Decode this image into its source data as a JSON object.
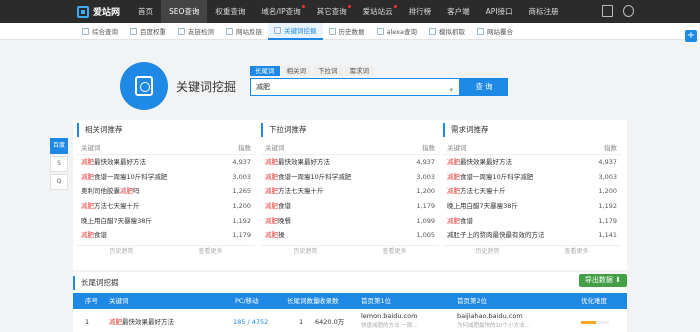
{
  "brand": {
    "name": "爱站网"
  },
  "topnav": {
    "items": [
      {
        "label": "首页"
      },
      {
        "label": "SEO查询",
        "active": true
      },
      {
        "label": "权重查询"
      },
      {
        "label": "域名/IP查询",
        "dot": true
      },
      {
        "label": "其它查询",
        "dot": true
      },
      {
        "label": "爱站站云",
        "dot": true
      },
      {
        "label": "排行榜"
      },
      {
        "label": "客户端"
      },
      {
        "label": "API接口"
      },
      {
        "label": "商标注册"
      }
    ]
  },
  "subnav": {
    "items": [
      {
        "label": "综合查询"
      },
      {
        "label": "百度权重"
      },
      {
        "label": "友链检测"
      },
      {
        "label": "网站反链"
      },
      {
        "label": "关键词挖掘",
        "active": true
      },
      {
        "label": "历史数据"
      },
      {
        "label": "alexa查询"
      },
      {
        "label": "模拟抓取"
      },
      {
        "label": "网站覆合"
      }
    ]
  },
  "fab": {
    "label": "+"
  },
  "hero": {
    "title": "关键词挖掘"
  },
  "search": {
    "tabs": [
      "长尾词",
      "相关词",
      "下拉词",
      "需求词"
    ],
    "value": "减肥",
    "button": "查 询"
  },
  "sidenav": {
    "items": [
      "百度",
      "S",
      "Q"
    ]
  },
  "panels": [
    {
      "title": "相关词推荐",
      "col_kw": "关键词",
      "col_idx": "指数",
      "rows": [
        {
          "pre": "",
          "hl": "减肥",
          "post": "最快效果最好方法",
          "v": "4,937"
        },
        {
          "pre": "",
          "hl": "减肥",
          "post": "食谱一周瘦10斤科学减肥",
          "v": "3,003"
        },
        {
          "pre": "奥利司他胶囊",
          "hl": "减肥",
          "post": "吗",
          "v": "1,265"
        },
        {
          "pre": "",
          "hl": "减肥",
          "post": "方法七天瘦十斤",
          "v": "1,200"
        },
        {
          "pre": "晚上用白醋7天暴瘦38斤",
          "hl": "",
          "post": "",
          "v": "1,192"
        },
        {
          "pre": "",
          "hl": "减肥",
          "post": "食谱",
          "v": "1,179"
        }
      ],
      "foot_a": "历史趋势",
      "foot_b": "查看更多"
    },
    {
      "title": "下拉词推荐",
      "col_kw": "关键词",
      "col_idx": "指数",
      "rows": [
        {
          "pre": "",
          "hl": "减肥",
          "post": "最快效果最好方法",
          "v": "4,937"
        },
        {
          "pre": "",
          "hl": "减肥",
          "post": "食谱一周瘦10斤科学减肥",
          "v": "3,003"
        },
        {
          "pre": "",
          "hl": "减肥",
          "post": "方法七天瘦十斤",
          "v": "1,200"
        },
        {
          "pre": "",
          "hl": "减肥",
          "post": "食谱",
          "v": "1,179"
        },
        {
          "pre": "",
          "hl": "减肥",
          "post": "晚餐",
          "v": "1,099"
        },
        {
          "pre": "",
          "hl": "减肥",
          "post": "操",
          "v": "1,005"
        }
      ],
      "foot_a": "历史趋势",
      "foot_b": "查看更多"
    },
    {
      "title": "需求词推荐",
      "col_kw": "关键词",
      "col_idx": "指数",
      "rows": [
        {
          "pre": "",
          "hl": "减肥",
          "post": "最快效果最好方法",
          "v": "4,937"
        },
        {
          "pre": "",
          "hl": "减肥",
          "post": "食谱一周瘦10斤科学减肥",
          "v": "3,003"
        },
        {
          "pre": "",
          "hl": "减肥",
          "post": "方法七天瘦十斤",
          "v": "1,200"
        },
        {
          "pre": "晚上用白醋7天暴瘦38斤",
          "hl": "",
          "post": "",
          "v": "1,192"
        },
        {
          "pre": "",
          "hl": "减肥",
          "post": "食谱",
          "v": "1,179"
        },
        {
          "pre": "减肚子上的赘肉最快最有效的方法",
          "hl": "",
          "post": "",
          "v": "1,141"
        }
      ],
      "foot_a": "历史趋势",
      "foot_b": "查看更多"
    }
  ],
  "longtail": {
    "title": "长尾词挖掘",
    "export": "导出数据 ⬇",
    "headers": [
      "序号",
      "关键词",
      "PC/移动",
      "长尾词数量",
      "收录数",
      "首页第1位",
      "首页第2位",
      "优化难度"
    ],
    "row": {
      "idx": "1",
      "kw_hl": "减肥",
      "kw_post": "最快效果最好方法",
      "pcm": "185 / 4752",
      "count": "1",
      "indexed": "6420.0万",
      "first": "lemon.baidu.com",
      "first_sub": "快速减肥的方法 一周…",
      "second": "baijiahao.baidu.com",
      "second_sub": "为何减肥最快的10个小方法…",
      "difficulty": 0.55
    }
  }
}
